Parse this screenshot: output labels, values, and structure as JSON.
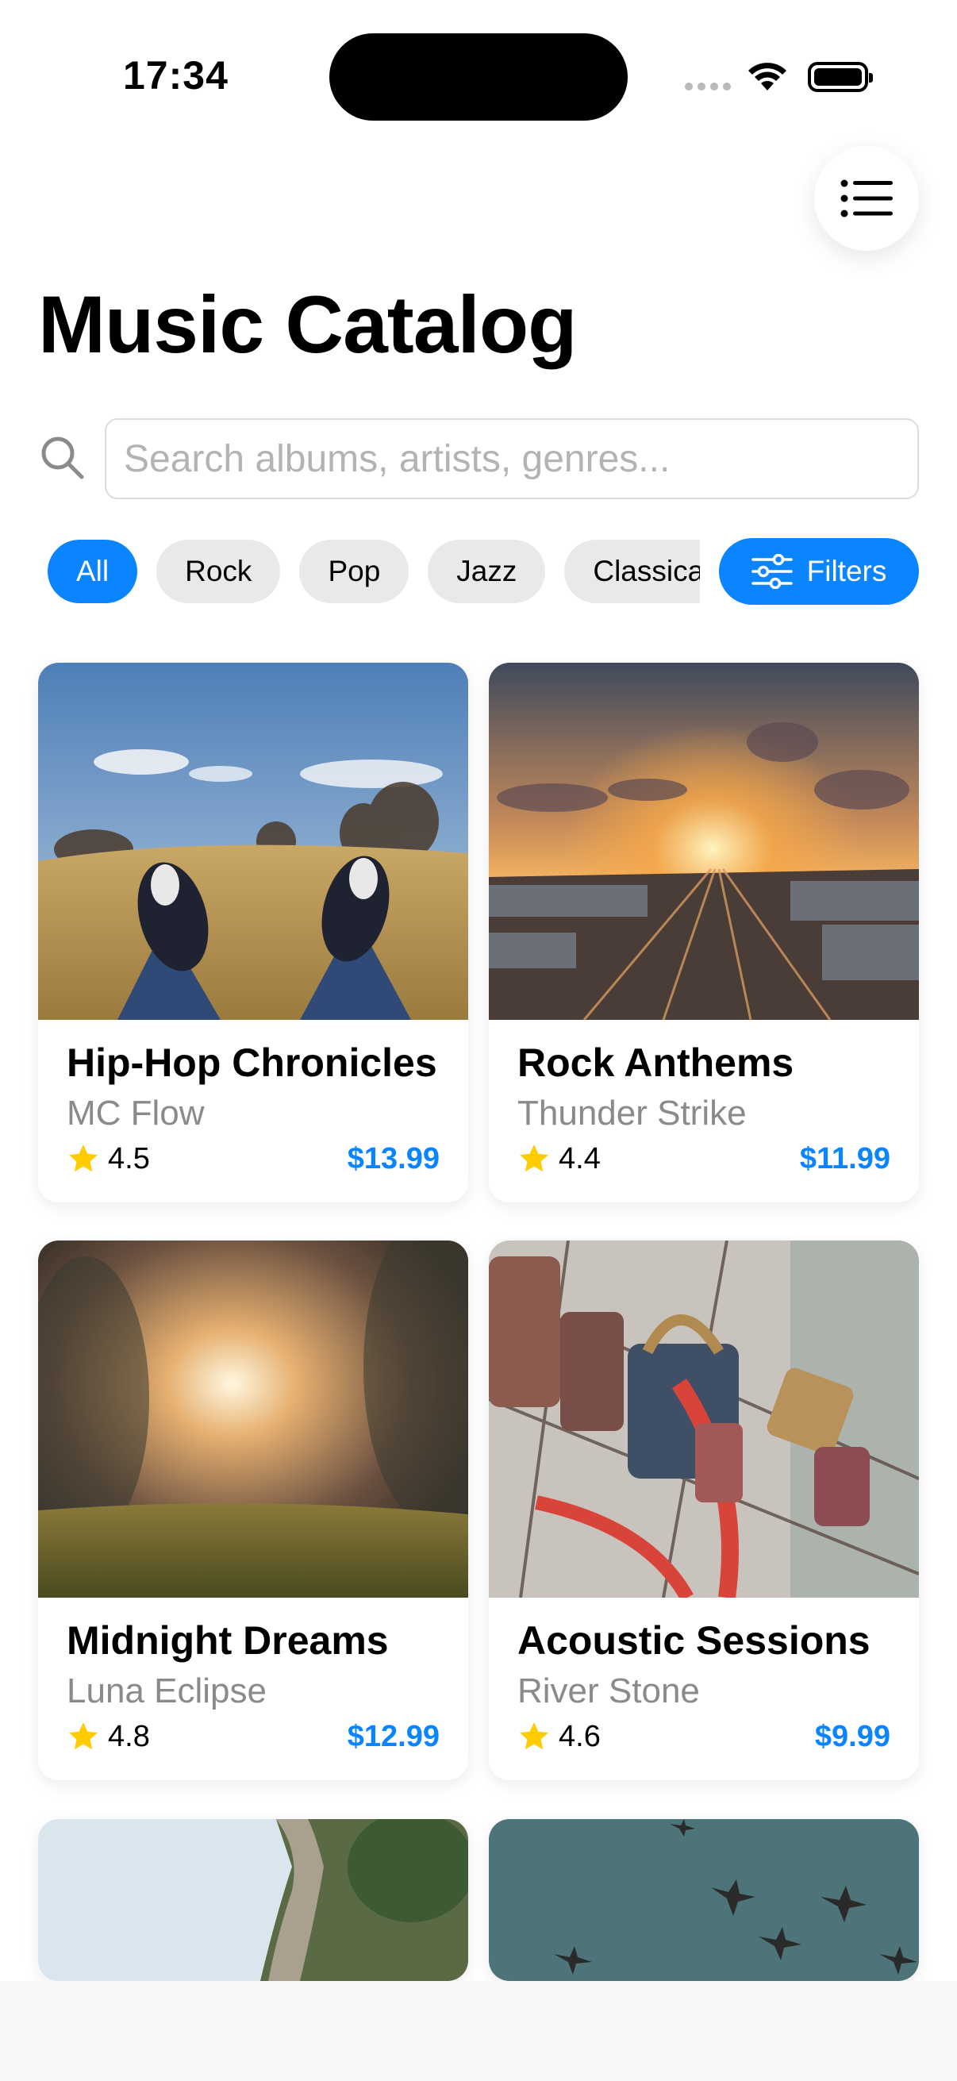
{
  "status_bar": {
    "time": "17:34"
  },
  "header": {
    "title": "Music Catalog",
    "menu_icon": "list-icon"
  },
  "search": {
    "placeholder": "Search albums, artists, genres...",
    "value": ""
  },
  "genres": [
    "All",
    "Rock",
    "Pop",
    "Jazz",
    "Classical"
  ],
  "active_genre": "All",
  "filters_button": {
    "label": "Filters",
    "icon": "sliders-icon"
  },
  "albums": [
    {
      "title": "Hip-Hop Chronicles",
      "artist": "MC Flow",
      "rating": "4.5",
      "price": "$13.99",
      "image": "sneakers-field-photo"
    },
    {
      "title": "Rock Anthems",
      "artist": "Thunder Strike",
      "rating": "4.4",
      "price": "$11.99",
      "image": "railway-sunset-photo"
    },
    {
      "title": "Midnight Dreams",
      "artist": "Luna Eclipse",
      "rating": "4.8",
      "price": "$12.99",
      "image": "sunlit-grass-photo"
    },
    {
      "title": "Acoustic Sessions",
      "artist": "River Stone",
      "rating": "4.6",
      "price": "$9.99",
      "image": "love-locks-photo"
    },
    {
      "image": "cliff-trees-photo"
    },
    {
      "image": "birds-sky-photo"
    }
  ],
  "colors": {
    "accent": "#0a84ff",
    "star": "#ffcc00",
    "chip": "#e9e9e9"
  }
}
